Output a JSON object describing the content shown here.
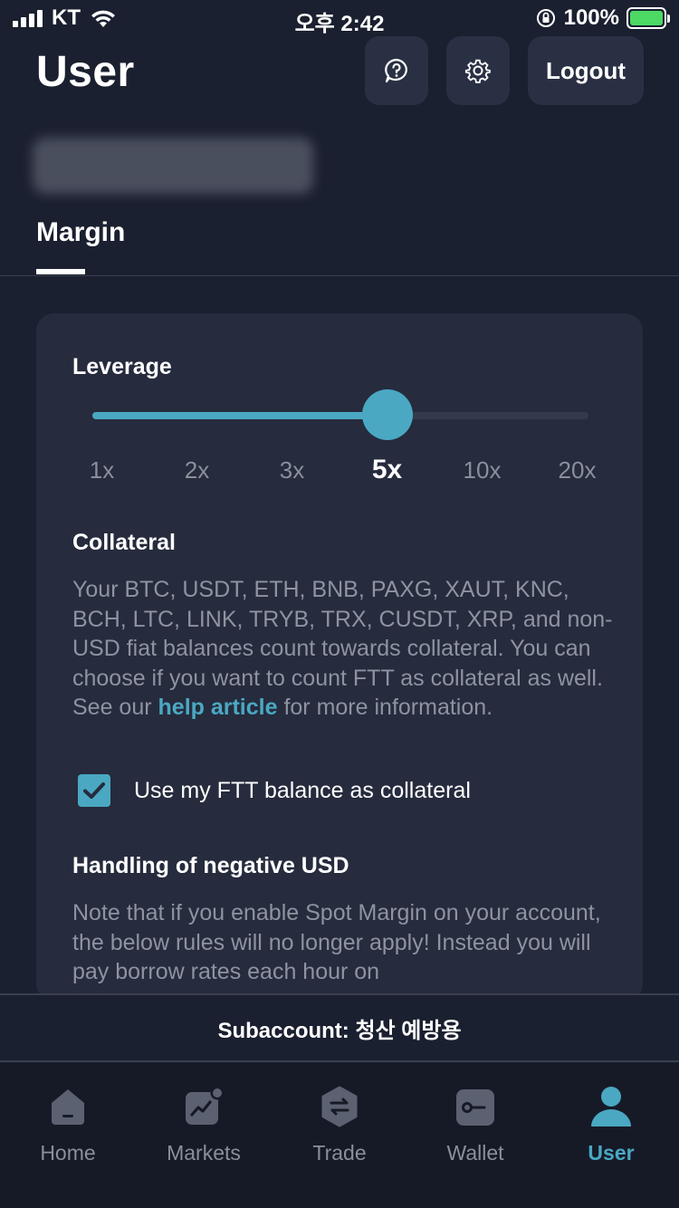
{
  "status_bar": {
    "carrier": "KT",
    "time": "오후 2:42",
    "battery": "100%"
  },
  "header": {
    "title": "User",
    "logout_label": "Logout"
  },
  "account_name": "",
  "tabs": [
    {
      "label": "Margin",
      "active": true
    }
  ],
  "leverage": {
    "title": "Leverage",
    "options": [
      "1x",
      "2x",
      "3x",
      "5x",
      "10x",
      "20x"
    ],
    "selected": "5x",
    "selected_index": 3
  },
  "collateral": {
    "title": "Collateral",
    "text_before": "Your BTC, USDT, ETH, BNB, PAXG, XAUT, KNC, BCH, LTC, LINK, TRYB, TRX, CUSDT, XRP, and non-USD fiat balances count towards collateral. You can choose if you want to count FTT as collateral as well. See our ",
    "link_text": "help article",
    "text_after": " for more information.",
    "checkbox_label": "Use my FTT balance as collateral",
    "checkbox_checked": true
  },
  "negative_usd": {
    "title": "Handling of negative USD",
    "text": "Note that if you enable Spot Margin on your account, the below rules will no longer apply! Instead you will pay borrow rates each hour on"
  },
  "subaccount": {
    "label": "Subaccount: 청산 예방용"
  },
  "bottom_nav": {
    "items": [
      {
        "label": "Home",
        "icon": "home-icon"
      },
      {
        "label": "Markets",
        "icon": "markets-icon"
      },
      {
        "label": "Trade",
        "icon": "trade-icon"
      },
      {
        "label": "Wallet",
        "icon": "wallet-icon"
      },
      {
        "label": "User",
        "icon": "user-icon",
        "active": true
      }
    ]
  },
  "colors": {
    "accent": "#4aa8c2",
    "background": "#1b2030",
    "card": "#262b3d"
  }
}
